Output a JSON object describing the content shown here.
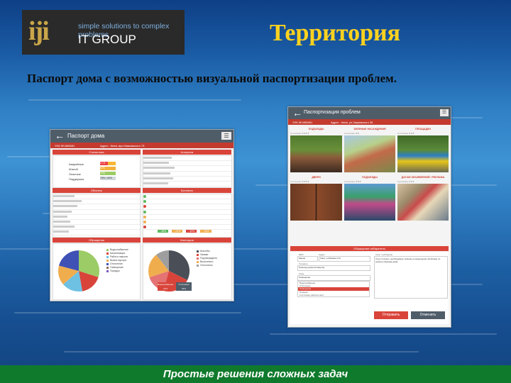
{
  "logo": {
    "mark": "iji",
    "tagline": "simple solutions to complex problems",
    "group": "IT GROUP"
  },
  "slide": {
    "title": "Территория",
    "subtitle": "Паспорт дома с возможностью визуальной паспортизации проблем.",
    "footer": "Простые решения сложных задач"
  },
  "screen_left": {
    "header_title": "Паспорт дома",
    "id_label": "УНК МЧ456681",
    "address": "Адрес : Киев, вул.Маяковского 7б",
    "sections": {
      "stats": "Статистика",
      "alerts": "Алгоритм",
      "objects": "Объекты",
      "contacts": "Контакты",
      "appeals": "Обращения",
      "categories": "Категории"
    },
    "stats_rows": [
      {
        "label": "Аварийные",
        "value": "2 / 5"
      },
      {
        "label": "Жилой",
        "value": "87%"
      },
      {
        "label": "Опасные",
        "value": "72%"
      },
      {
        "label": "Поддержка",
        "value": "79% / 42%"
      }
    ],
    "badges": [
      "- 45%",
      "- 22%",
      "- 44%",
      "- 30%"
    ],
    "pie1_legend": [
      "Водоснабжение",
      "Канализация",
      "Работа лифтов",
      "Вывоз мусора",
      "Отопление",
      "Освещение",
      "Порядок"
    ],
    "pie2_legend": [
      "Жалобы",
      "Заявки",
      "Подтверждено",
      "Выполнено",
      "Отклонено"
    ],
    "buttons": [
      "Водоснабжение",
      "Отопление"
    ],
    "button_values": [
      "74%",
      "26%"
    ]
  },
  "screen_right": {
    "header_title": "Паспортизация проблем",
    "id_label": "УНК МЧ456681",
    "address": "Адрес : Киев, ул.Закревского 35",
    "tiles": [
      {
        "caption": "ПОДЪЕЗДЫ",
        "sub": "Состояние ★★★★"
      },
      {
        "caption": "ЗЕЛЕНЫЕ НАСАЖДЕНИЯ",
        "sub": "Состояние ★★"
      },
      {
        "caption": "ПЛОЩАДКИ",
        "sub": "Состояние ★★★"
      },
      {
        "caption": "ДВЕРИ",
        "sub": "Состояние ★★★★"
      },
      {
        "caption": "ПОДЪЕЗДЫ",
        "sub": "Состояние ★★★"
      },
      {
        "caption": "ДОСКИ ОБЪЯВЛЕНИЙ / РЕКЛАМА",
        "sub": "Состояние ★★★"
      }
    ],
    "form_title": "Обращение избирателя",
    "form_labels": {
      "name": "ФИО",
      "address": "Адрес",
      "phone": "Телефон",
      "topic": "Тема",
      "text": "Текст сообщения"
    },
    "form_values": {
      "name": "Іванов",
      "address": "Киев, ул.Бажана 17а",
      "phone": "Розклад ремонтів квартир"
    },
    "dropdown_selected": "Освещение",
    "dropdown_options": [
      "Водоснабжение",
      "Отопление",
      "Освещение",
      "Порядок",
      "Состояние рабочих мест"
    ],
    "message_text": "Хочу получить необходимую помощь в разрешении проблемы по ремонту фасада дома.",
    "send": "Отправить",
    "cancel": "Отменить"
  },
  "colors": {
    "accent_red": "#d9443a",
    "header": "#4f5d69",
    "title_yellow": "#ffd21e",
    "footer_green": "#0f7a2c"
  }
}
